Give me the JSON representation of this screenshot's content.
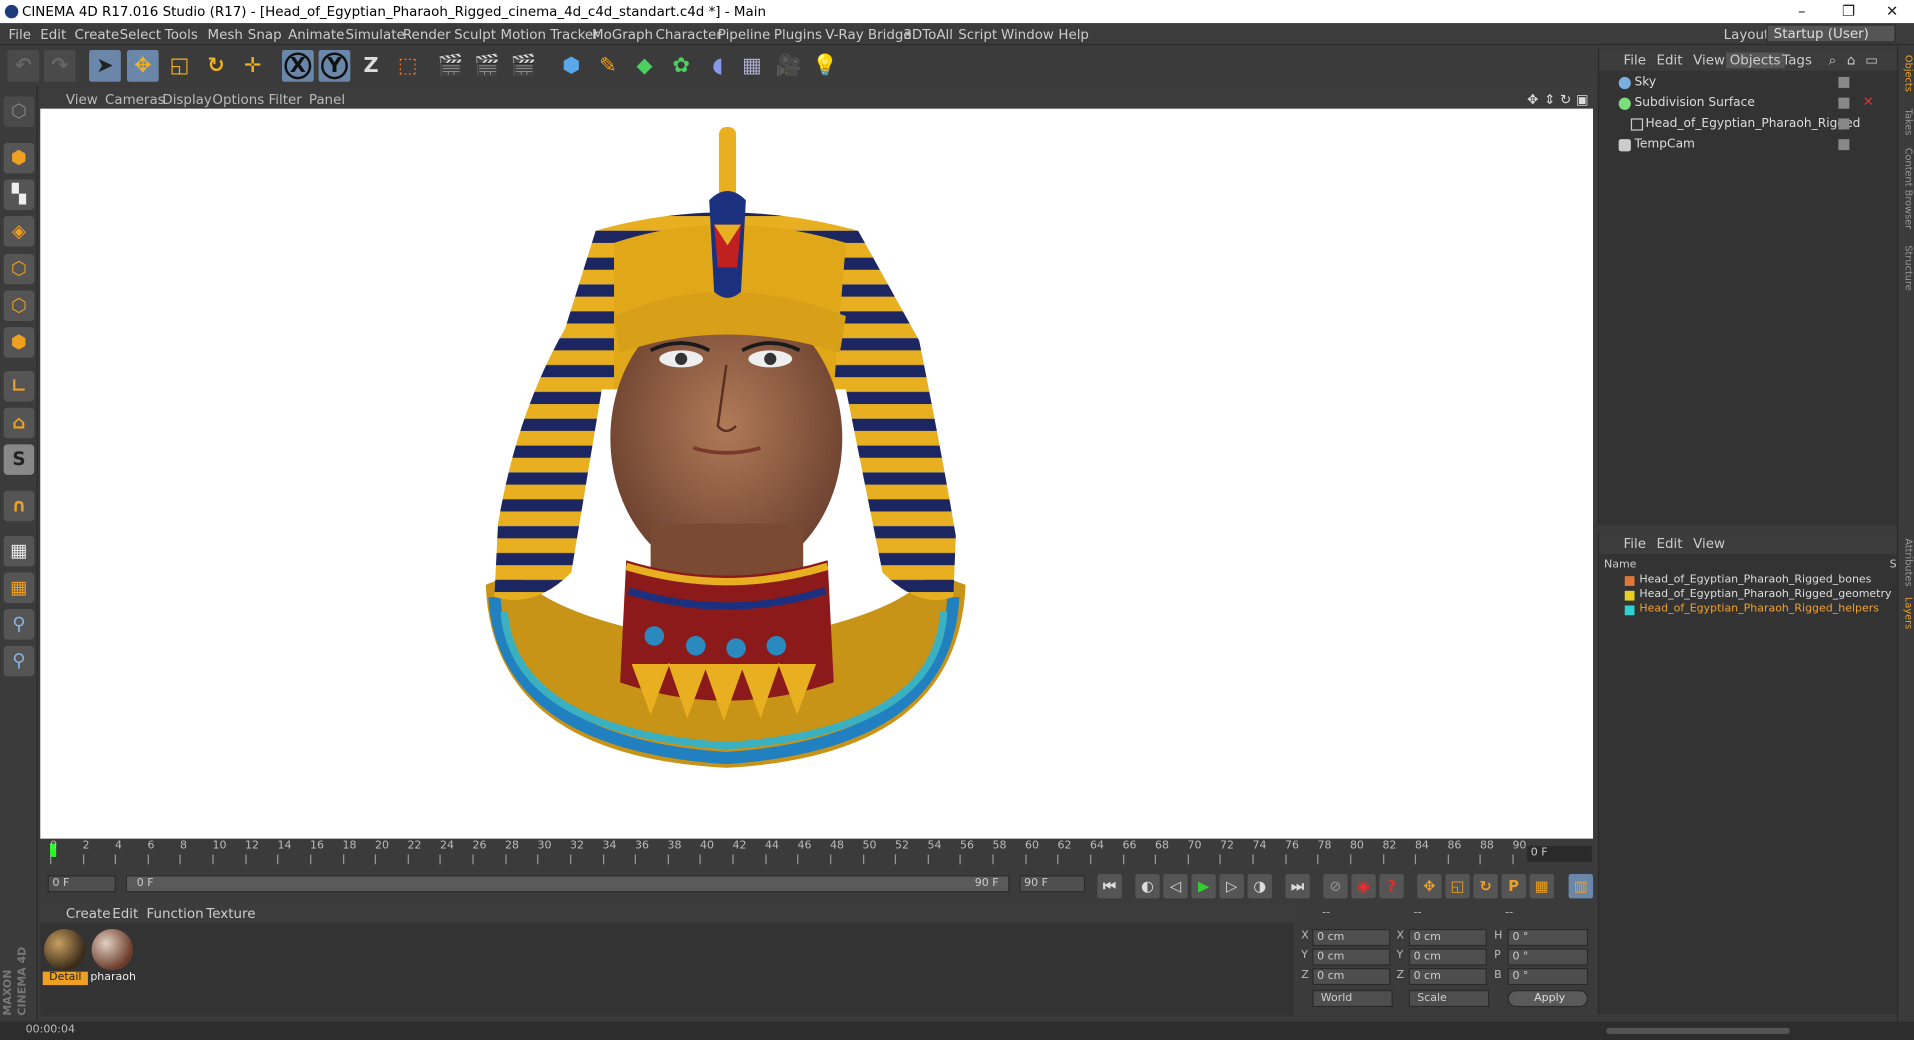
{
  "window": {
    "title": "CINEMA 4D R17.016 Studio (R17) - [Head_of_Egyptian_Pharaoh_Rigged_cinema_4d_c4d_standart.c4d *] - Main",
    "minimize": "–",
    "restore": "❐",
    "close": "✕"
  },
  "menubar": {
    "items": [
      "File",
      "Edit",
      "Create",
      "Select",
      "Tools",
      "Mesh",
      "Snap",
      "Animate",
      "Simulate",
      "Render",
      "Sculpt",
      "Motion Tracker",
      "MoGraph",
      "Character",
      "Pipeline",
      "Plugins",
      "V-Ray Bridge",
      "3DToAll",
      "Script",
      "Window",
      "Help"
    ],
    "layout_label": "Layout:",
    "layout_value": "Startup (User)"
  },
  "toolbar": {
    "axis_x": "X",
    "axis_y": "Y",
    "axis_z": "Z"
  },
  "viewport": {
    "menu": [
      "View",
      "Cameras",
      "Display",
      "Options",
      "Filter",
      "Panel"
    ]
  },
  "timeline": {
    "ticks": [
      "0",
      "2",
      "4",
      "6",
      "8",
      "10",
      "12",
      "14",
      "16",
      "18",
      "20",
      "22",
      "24",
      "26",
      "28",
      "30",
      "32",
      "34",
      "36",
      "38",
      "40",
      "42",
      "44",
      "46",
      "48",
      "50",
      "52",
      "54",
      "56",
      "58",
      "60",
      "62",
      "64",
      "66",
      "68",
      "70",
      "72",
      "74",
      "76",
      "78",
      "80",
      "82",
      "84",
      "86",
      "88",
      "90"
    ],
    "current_frame": "0 F"
  },
  "transport": {
    "start_field": "0 F",
    "range_start": "0 F",
    "range_end": "90 F",
    "end_field": "90 F"
  },
  "materials": {
    "menu": [
      "Create",
      "Edit",
      "Function",
      "Texture"
    ],
    "items": [
      {
        "label": "Detail",
        "selected": true
      },
      {
        "label": "pharaoh",
        "selected": false
      }
    ]
  },
  "coordinates": {
    "header": [
      "--",
      "--",
      "--"
    ],
    "rows": [
      {
        "a": "X",
        "av": "0 cm",
        "b": "X",
        "bv": "0 cm",
        "c": "H",
        "cv": "0 °"
      },
      {
        "a": "Y",
        "av": "0 cm",
        "b": "Y",
        "bv": "0 cm",
        "c": "P",
        "cv": "0 °"
      },
      {
        "a": "Z",
        "av": "0 cm",
        "b": "Z",
        "bv": "0 cm",
        "c": "B",
        "cv": "0 °"
      }
    ],
    "mode1": "World",
    "mode2": "Scale",
    "apply": "Apply"
  },
  "objects": {
    "menu": [
      "File",
      "Edit",
      "View",
      "Objects",
      "Tags"
    ],
    "items": [
      {
        "name": "Sky",
        "icon_color": "#7ab0e0"
      },
      {
        "name": "Subdivision Surface",
        "icon_color": "#7adf7a"
      },
      {
        "name": "Head_of_Egyptian_Pharaoh_Rigged",
        "icon_color": "#cccccc"
      },
      {
        "name": "TempCam",
        "icon_color": "#cccccc"
      }
    ]
  },
  "layers": {
    "menu": [
      "File",
      "Edit",
      "View"
    ],
    "col_name": "Name",
    "col_s": "S",
    "items": [
      {
        "name": "Head_of_Egyptian_Pharaoh_Rigged_bones",
        "color": "#e0773a",
        "text_color": "#dddddd"
      },
      {
        "name": "Head_of_Egyptian_Pharaoh_Rigged_geometry",
        "color": "#e8d020",
        "text_color": "#dddddd"
      },
      {
        "name": "Head_of_Egyptian_Pharaoh_Rigged_helpers",
        "color": "#30d0d0",
        "text_color": "#f0a030"
      }
    ]
  },
  "side_tabs": [
    "Objects",
    "Takes",
    "Content Browser",
    "Structure",
    "Attributes",
    "Layers"
  ],
  "status": {
    "time": "00:00:04"
  },
  "branding": "MAXON CINEMA 4D"
}
